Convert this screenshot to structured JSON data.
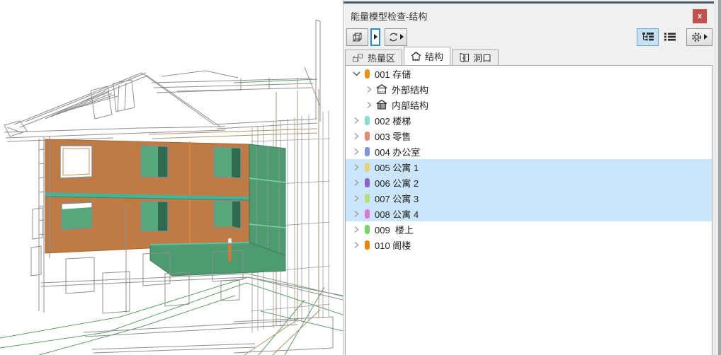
{
  "window": {
    "title": "能量模型检查-结构",
    "close_label": "x"
  },
  "toolbar": {
    "left_buttons": [
      {
        "name": "model-3d-view",
        "icon": "cube-3d-icon"
      },
      {
        "name": "model-3d-flyout",
        "icon": "flyout-arrow-icon",
        "selected": true
      },
      {
        "name": "refresh",
        "icon": "refresh-icon",
        "has_flyout": true
      }
    ],
    "right_buttons": [
      {
        "name": "tree-view-toggle",
        "icon": "tree-view-icon",
        "active": true
      },
      {
        "name": "flat-list-toggle",
        "icon": "list-view-icon",
        "active": false
      },
      {
        "name": "settings",
        "icon": "gear-icon",
        "has_flyout": true
      }
    ]
  },
  "tabs": [
    {
      "label": "热量区",
      "icon": "thermal-blocks-icon",
      "active": false
    },
    {
      "label": "结构",
      "icon": "structure-house-icon",
      "active": true
    },
    {
      "label": "洞口",
      "icon": "opening-door-icon",
      "active": false
    }
  ],
  "tree": {
    "selection_color": "#CBE6FA",
    "items": [
      {
        "label": "001 存储",
        "swatch": "#E8941A",
        "level": 0,
        "expanded": true,
        "selected": false
      },
      {
        "label": "外部结构",
        "icon": "house-outline-icon",
        "level": 1,
        "expanded": false,
        "selected": false
      },
      {
        "label": "内部结构",
        "icon": "house-filled-icon",
        "level": 1,
        "expanded": false,
        "selected": false
      },
      {
        "label": "002 楼梯",
        "swatch": "#86DFD2",
        "level": 0,
        "expanded": false,
        "selected": false
      },
      {
        "label": "003 零售",
        "swatch": "#DE8F75",
        "level": 0,
        "expanded": false,
        "selected": false
      },
      {
        "label": "004 办公室",
        "swatch": "#7E97DB",
        "level": 0,
        "expanded": false,
        "selected": false
      },
      {
        "label": "005 公寓 1",
        "swatch": "#E4D27D",
        "level": 0,
        "expanded": false,
        "selected": true
      },
      {
        "label": "006 公寓 2",
        "swatch": "#8A66C8",
        "level": 0,
        "expanded": false,
        "selected": true
      },
      {
        "label": "007 公寓 3",
        "swatch": "#B3DF7A",
        "level": 0,
        "expanded": false,
        "selected": true
      },
      {
        "label": "008 公寓 4",
        "swatch": "#D878DA",
        "level": 0,
        "expanded": false,
        "selected": true
      },
      {
        "label": "009  楼上",
        "swatch": "#76D367",
        "level": 0,
        "expanded": false,
        "selected": false
      },
      {
        "label": "010 阁楼",
        "swatch": "#E8860D",
        "level": 0,
        "expanded": false,
        "selected": false
      }
    ]
  },
  "viewport": {
    "colors": {
      "wall_orange": "#C07B44",
      "panel_green": "#4E9B72",
      "window_green_light": "#57A77D",
      "window_green_dark": "#2E6B4D",
      "floor_band_teal": "#47B295",
      "wireframe_gray": "#8F8F8F",
      "wireframe_tan": "#AD9468",
      "terrain_green": "#5E9E66"
    }
  }
}
